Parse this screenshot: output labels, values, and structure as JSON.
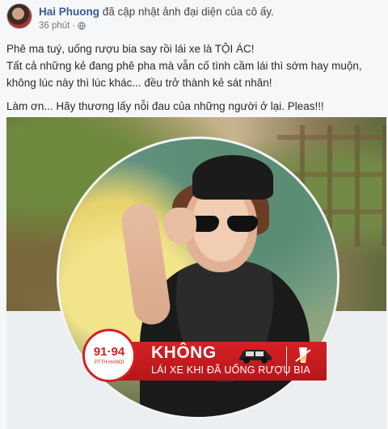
{
  "post": {
    "author": "Hai Phuong",
    "action": "đã cập nhật ảnh đại diện của cô ấy.",
    "time": "36 phút",
    "globe_icon": "globe-icon",
    "lines": [
      "Phê ma tuý, uống rượu bia say rồi lái xe là TỘI ÁC!",
      "Tất cả những kẻ đang phê pha mà vẫn cố tình cầm lái thì sớm hay muộn,",
      "không lúc này thì lúc khác... đều trở thành kẻ sát nhân!",
      "Làm ơn... Hãy thương lấy nỗi đau của những người ở lại. Pleas!!!"
    ]
  },
  "banner": {
    "badge_number": "91·94",
    "badge_sub": "PTTH HANOI",
    "headline": "KHÔNG",
    "subline": "LÁI XE KHI ĐÃ UỐNG RƯỢU BIA",
    "icons": [
      "car-icon",
      "drink-icon"
    ],
    "color": "#d62024"
  }
}
